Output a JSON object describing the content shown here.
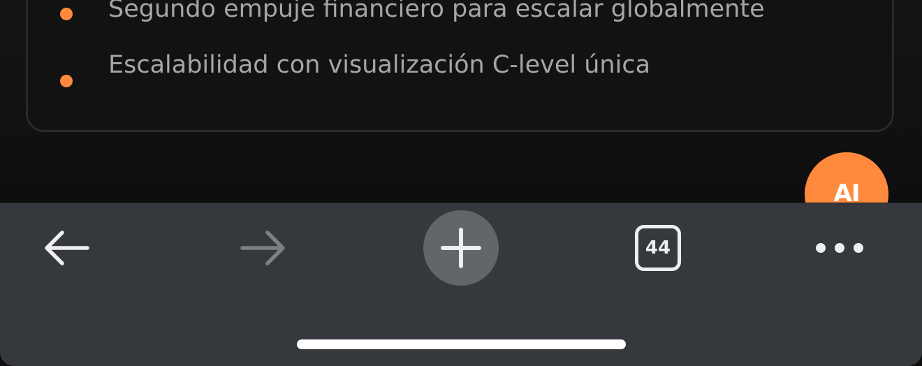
{
  "page": {
    "bullets": [
      {
        "text": "Segundo empuje financiero para escalar globalmente"
      },
      {
        "text": "Escalabilidad con visualización C-level única"
      }
    ],
    "ai_fab_label": "AI"
  },
  "toolbar": {
    "back_icon": "arrow-left-icon",
    "forward_icon": "arrow-right-icon",
    "new_tab_icon": "plus-icon",
    "tab_count": "44",
    "more_icon": "ellipsis-icon"
  },
  "colors": {
    "accent": "#ff8a3d",
    "toolbar_bg": "#35383c",
    "page_bg": "#111111"
  }
}
